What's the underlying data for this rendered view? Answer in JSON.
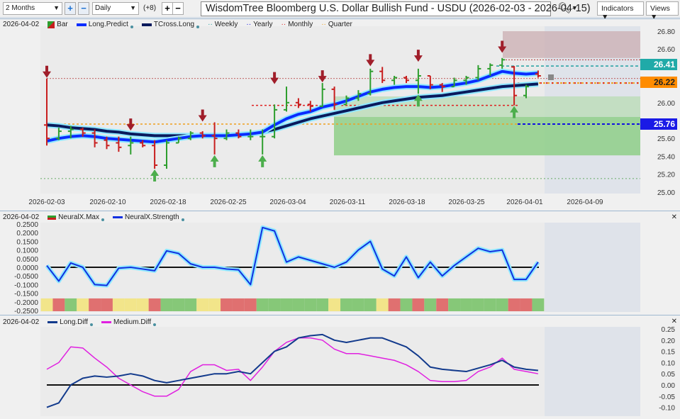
{
  "toolbar": {
    "range": "2 Months",
    "interval": "Daily",
    "offset": "(+8)",
    "title": "WisdomTree Bloomberg U.S. Dollar Bullish Fund - USDU (2026-02-03 - 2026-04-15)",
    "indicators": "Indicators",
    "views": "Views",
    "plus": "+",
    "minus": "−",
    "search_icon": "magnifier-icon"
  },
  "colors": {
    "long_predict": "#0a2cff",
    "tcross_long": "#0a1a5c",
    "weekly": "#20a0a0",
    "yearly": "#1010e0",
    "monthly": "#e02020",
    "quarter": "#f0a020",
    "neural_strength": "#1030e0",
    "long_diff": "#123a8c",
    "medium_diff": "#e020e0",
    "up": "#2e9e2e",
    "down": "#c81e1e"
  },
  "price_panel": {
    "date": "2026-04-02",
    "legend": [
      "Bar",
      "Long.Predict",
      "TCross.Long",
      "Weekly",
      "Yearly",
      "Monthly",
      "Quarter"
    ],
    "labels": {
      "weekly": "26.41",
      "quarter": "26.22",
      "yearly": "25.76"
    }
  },
  "neural_panel": {
    "date": "2026-04-02",
    "legend": [
      "NeuralX.Max",
      "NeuralX.Strength"
    ]
  },
  "diff_panel": {
    "date": "2026-04-02",
    "legend": [
      "Long.Diff",
      "Medium.Diff"
    ]
  },
  "chart_data": [
    {
      "type": "bar",
      "name": "price",
      "ylim": [
        25.0,
        26.8
      ],
      "yticks": [
        "26.80",
        "26.60",
        "26.40",
        "26.20",
        "26.00",
        "25.80",
        "25.60",
        "25.40",
        "25.20",
        "25.00"
      ],
      "xticks": [
        "2026-02-03",
        "2026-02-10",
        "2026-02-18",
        "2026-02-25",
        "2026-03-04",
        "2026-03-11",
        "2026-03-18",
        "2026-03-25",
        "2026-04-01",
        "2026-04-09"
      ],
      "ohlc": [
        [
          25.75,
          26.27,
          25.52,
          25.6
        ],
        [
          25.6,
          25.72,
          25.58,
          25.68
        ],
        [
          25.68,
          25.74,
          25.6,
          25.7
        ],
        [
          25.7,
          25.72,
          25.62,
          25.66
        ],
        [
          25.66,
          25.7,
          25.5,
          25.55
        ],
        [
          25.58,
          25.62,
          25.48,
          25.52
        ],
        [
          25.55,
          25.62,
          25.45,
          25.5
        ],
        [
          25.52,
          25.62,
          25.42,
          25.55
        ],
        [
          25.55,
          25.58,
          25.5,
          25.52
        ],
        [
          25.52,
          25.58,
          25.26,
          25.3
        ],
        [
          25.3,
          25.58,
          25.26,
          25.55
        ],
        [
          25.55,
          25.62,
          25.55,
          25.6
        ],
        [
          25.6,
          25.68,
          25.58,
          25.66
        ],
        [
          25.66,
          25.68,
          25.6,
          25.63
        ],
        [
          25.63,
          25.78,
          25.42,
          25.6
        ],
        [
          25.6,
          25.7,
          25.58,
          25.66
        ],
        [
          25.66,
          25.7,
          25.6,
          25.62
        ],
        [
          25.62,
          25.7,
          25.58,
          25.62
        ],
        [
          25.62,
          25.7,
          25.42,
          25.62
        ],
        [
          25.62,
          25.98,
          25.6,
          25.92
        ],
        [
          25.92,
          26.18,
          25.9,
          26.0
        ],
        [
          26.0,
          26.05,
          25.94,
          25.98
        ],
        [
          25.98,
          26.02,
          25.9,
          25.96
        ],
        [
          25.96,
          26.22,
          25.95,
          26.15
        ],
        [
          26.15,
          26.18,
          25.92,
          25.98
        ],
        [
          25.98,
          26.08,
          25.98,
          26.05
        ],
        [
          26.05,
          26.14,
          26.02,
          26.1
        ],
        [
          26.1,
          26.38,
          26.08,
          26.35
        ],
        [
          26.35,
          26.4,
          26.22,
          26.25
        ],
        [
          26.25,
          26.3,
          26.2,
          26.28
        ],
        [
          26.28,
          26.3,
          26.22,
          26.25
        ],
        [
          26.25,
          26.38,
          26.1,
          26.3
        ],
        [
          26.3,
          26.3,
          26.15,
          26.2
        ],
        [
          26.2,
          26.22,
          26.12,
          26.18
        ],
        [
          26.18,
          26.28,
          26.18,
          26.25
        ],
        [
          26.25,
          26.3,
          26.2,
          26.28
        ],
        [
          26.28,
          26.42,
          26.25,
          26.38
        ],
        [
          26.38,
          26.44,
          26.3,
          26.42
        ],
        [
          26.42,
          26.5,
          26.38,
          26.48
        ],
        [
          26.4,
          26.41,
          25.97,
          26.08
        ],
        [
          26.08,
          26.2,
          26.05,
          26.18
        ],
        [
          26.32,
          26.36,
          26.28,
          26.3
        ]
      ],
      "long_predict": [
        25.57,
        25.6,
        25.62,
        25.63,
        25.62,
        25.6,
        25.59,
        25.58,
        25.57,
        25.56,
        25.58,
        25.6,
        25.62,
        25.63,
        25.63,
        25.63,
        25.64,
        25.65,
        25.67,
        25.75,
        25.82,
        25.87,
        25.9,
        25.95,
        25.98,
        26.02,
        26.07,
        26.12,
        26.15,
        26.17,
        26.18,
        26.18,
        26.17,
        26.18,
        26.2,
        26.22,
        26.25,
        26.3,
        26.35,
        26.33,
        26.32,
        26.33
      ],
      "tcross_long": [
        25.75,
        25.74,
        25.72,
        25.71,
        25.7,
        25.68,
        25.67,
        25.65,
        25.64,
        25.63,
        25.63,
        25.63,
        25.63,
        25.63,
        25.63,
        25.63,
        25.64,
        25.65,
        25.67,
        25.7,
        25.74,
        25.78,
        25.82,
        25.85,
        25.88,
        25.91,
        25.94,
        25.97,
        26.0,
        26.02,
        26.04,
        26.06,
        26.07,
        26.08,
        26.1,
        26.12,
        26.14,
        26.16,
        26.18,
        26.19,
        26.2,
        26.21
      ],
      "arrows": [
        {
          "i": 0,
          "dir": "down",
          "price": 26.27
        },
        {
          "i": 7,
          "dir": "down",
          "price": 25.68
        },
        {
          "i": 9,
          "dir": "up",
          "price": 25.26
        },
        {
          "i": 13,
          "dir": "down",
          "price": 25.78
        },
        {
          "i": 14,
          "dir": "up",
          "price": 25.42
        },
        {
          "i": 18,
          "dir": "up",
          "price": 25.42
        },
        {
          "i": 19,
          "dir": "down",
          "price": 26.2
        },
        {
          "i": 23,
          "dir": "down",
          "price": 26.22
        },
        {
          "i": 27,
          "dir": "down",
          "price": 26.4
        },
        {
          "i": 31,
          "dir": "down",
          "price": 26.45
        },
        {
          "i": 31,
          "dir": "up",
          "price": 26.1
        },
        {
          "i": 38,
          "dir": "down",
          "price": 26.55
        },
        {
          "i": 39,
          "dir": "up",
          "price": 25.97
        }
      ],
      "levels": {
        "weekly": 26.41,
        "quarter": 26.22,
        "yearly": 25.76,
        "monthly": 26.48
      }
    },
    {
      "type": "line",
      "name": "neuralx",
      "ylim": [
        -0.25,
        0.25
      ],
      "yticks": [
        "0.2500",
        "0.2000",
        "0.1500",
        "0.1000",
        "0.0500",
        "0.0000",
        "-0.0500",
        "-0.1000",
        "-0.1500",
        "-0.2000",
        "-0.2500"
      ],
      "strength": [
        0.01,
        -0.08,
        0.025,
        0.0,
        -0.1,
        -0.105,
        -0.005,
        0.0,
        -0.01,
        -0.02,
        0.095,
        0.08,
        0.02,
        0.0,
        0.0,
        -0.01,
        -0.015,
        -0.1,
        0.23,
        0.21,
        0.03,
        0.06,
        0.04,
        0.02,
        0.0,
        0.03,
        0.1,
        0.15,
        -0.01,
        -0.05,
        0.06,
        -0.06,
        0.03,
        -0.05,
        0.01,
        0.06,
        0.11,
        0.09,
        0.1,
        -0.07,
        -0.07,
        0.03
      ],
      "max": [
        "y",
        "r",
        "g",
        "y",
        "r",
        "r",
        "y",
        "y",
        "y",
        "r",
        "g",
        "g",
        "g",
        "y",
        "y",
        "r",
        "r",
        "r",
        "g",
        "g",
        "g",
        "g",
        "g",
        "g",
        "y",
        "g",
        "g",
        "g",
        "y",
        "r",
        "g",
        "r",
        "g",
        "r",
        "g",
        "g",
        "g",
        "g",
        "g",
        "r",
        "r",
        "g"
      ]
    },
    {
      "type": "line",
      "name": "diff",
      "ylim": [
        -0.1,
        0.25
      ],
      "yticks": [
        "0.25",
        "0.20",
        "0.15",
        "0.10",
        "0.05",
        "0.00",
        "-0.05",
        "-0.10"
      ],
      "long_diff": [
        -0.1,
        -0.08,
        0.0,
        0.03,
        0.04,
        0.035,
        0.04,
        0.05,
        0.04,
        0.02,
        0.01,
        0.02,
        0.03,
        0.04,
        0.05,
        0.05,
        0.06,
        0.05,
        0.1,
        0.15,
        0.17,
        0.21,
        0.22,
        0.225,
        0.2,
        0.19,
        0.2,
        0.21,
        0.21,
        0.19,
        0.17,
        0.13,
        0.08,
        0.07,
        0.065,
        0.06,
        0.075,
        0.09,
        0.11,
        0.08,
        0.07,
        0.065
      ],
      "medium_diff": [
        0.07,
        0.1,
        0.17,
        0.165,
        0.12,
        0.08,
        0.03,
        0.0,
        -0.03,
        -0.05,
        -0.05,
        -0.02,
        0.06,
        0.09,
        0.09,
        0.065,
        0.07,
        0.02,
        0.08,
        0.15,
        0.19,
        0.21,
        0.21,
        0.2,
        0.16,
        0.14,
        0.14,
        0.13,
        0.12,
        0.11,
        0.09,
        0.06,
        0.02,
        0.015,
        0.015,
        0.02,
        0.06,
        0.08,
        0.12,
        0.07,
        0.06,
        0.05
      ]
    }
  ]
}
